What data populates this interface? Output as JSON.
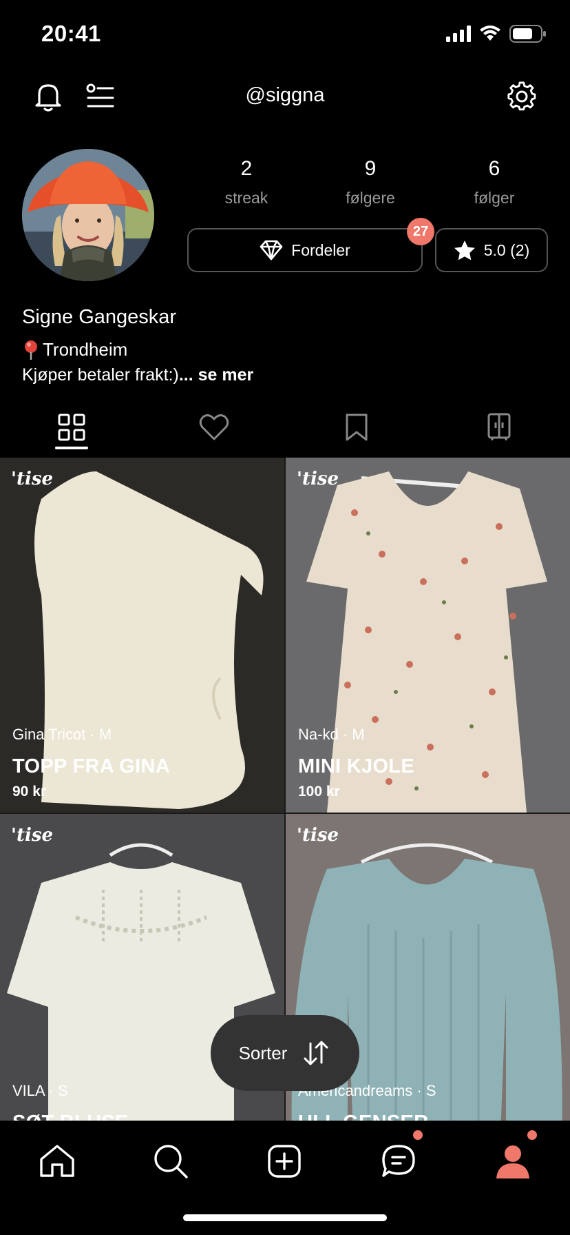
{
  "status_bar": {
    "time": "20:41"
  },
  "header": {
    "username": "@siggna",
    "icons": [
      "bell-icon",
      "list-icon",
      "gear-icon"
    ]
  },
  "profile": {
    "stats": [
      {
        "value": "2",
        "label": "streak"
      },
      {
        "value": "9",
        "label": "følgere"
      },
      {
        "value": "6",
        "label": "følger"
      }
    ],
    "benefits_label": "Fordeler",
    "benefits_badge": "27",
    "rating_label": "5.0 (2)",
    "name": "Signe Gangeskar",
    "location": "Trondheim",
    "bio_text": "Kjøper betaler frakt:)",
    "bio_more": "... se mer"
  },
  "tabs": [
    {
      "icon": "grid-icon",
      "active": true
    },
    {
      "icon": "heart-icon",
      "active": false
    },
    {
      "icon": "bookmark-icon",
      "active": false
    },
    {
      "icon": "wardrobe-icon",
      "active": false
    }
  ],
  "listings": [
    {
      "logo": "tise",
      "meta": "Gina Tricot · M",
      "title": "TOPP FRA GINA",
      "price": "90 kr"
    },
    {
      "logo": "tise",
      "meta": "Na-kd · M",
      "title": "MINI KJOLE",
      "price": "100 kr"
    },
    {
      "logo": "tise",
      "meta": "VILA · S",
      "title": "SØT BLUSE",
      "price": ""
    },
    {
      "logo": "tise",
      "meta": "Americandreams · S",
      "title": "ULL GENSER",
      "price": ""
    }
  ],
  "sort_button": {
    "label": "Sorter"
  },
  "bottom_nav": [
    "home-icon",
    "search-icon",
    "add-icon",
    "chat-icon",
    "profile-icon"
  ],
  "colors": {
    "accent": "#f0786a",
    "background": "#000000",
    "pill": "#333333"
  }
}
